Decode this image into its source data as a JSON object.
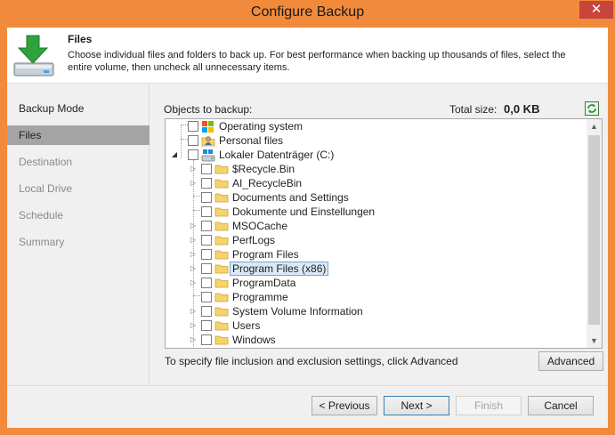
{
  "window": {
    "title": "Configure Backup",
    "close_glyph": "✕"
  },
  "header": {
    "title": "Files",
    "description": "Choose individual files and folders to back up. For best performance when backing up thousands of files, select the entire volume, then uncheck all unnecessary items.",
    "icon": "backup-drive-download-icon"
  },
  "sidebar": {
    "items": [
      {
        "label": "Backup Mode",
        "state": "done"
      },
      {
        "label": "Files",
        "state": "active"
      },
      {
        "label": "Destination",
        "state": "pending"
      },
      {
        "label": "Local Drive",
        "state": "pending"
      },
      {
        "label": "Schedule",
        "state": "pending"
      },
      {
        "label": "Summary",
        "state": "pending"
      }
    ]
  },
  "objects": {
    "label": "Objects to backup:",
    "total_size_label": "Total size:",
    "total_size_value": "0,0 KB"
  },
  "tree": {
    "roots": [
      {
        "label": "Operating system",
        "icon": "windows-logo-icon"
      },
      {
        "label": "Personal files",
        "icon": "user-folder-icon"
      },
      {
        "label": "Lokaler Datenträger (C:)",
        "icon": "drive-icon",
        "expanded": true
      }
    ],
    "children": [
      {
        "label": "$Recycle.Bin",
        "expandable": true
      },
      {
        "label": "AI_RecycleBin",
        "expandable": true
      },
      {
        "label": "Documents and Settings",
        "expandable": false
      },
      {
        "label": "Dokumente und Einstellungen",
        "expandable": false
      },
      {
        "label": "MSOCache",
        "expandable": true
      },
      {
        "label": "PerfLogs",
        "expandable": true
      },
      {
        "label": "Program Files",
        "expandable": true
      },
      {
        "label": "Program Files (x86)",
        "expandable": true,
        "selected": true
      },
      {
        "label": "ProgramData",
        "expandable": true
      },
      {
        "label": "Programme",
        "expandable": false
      },
      {
        "label": "System Volume Information",
        "expandable": true
      },
      {
        "label": "Users",
        "expandable": true
      },
      {
        "label": "Windows",
        "expandable": true
      }
    ]
  },
  "hint": "To specify file inclusion and exclusion settings, click Advanced",
  "buttons": {
    "advanced": "Advanced",
    "back": "< Previous",
    "next": "Next >",
    "finish": "Finish",
    "cancel": "Cancel"
  },
  "colors": {
    "window_frame": "#f28a3c",
    "close_button": "#c7453a",
    "sidebar_active": "#a4a4a4",
    "selection_fill": "#dbe8f7",
    "selection_border": "#7da2ce",
    "folder": "#f5d46c"
  }
}
